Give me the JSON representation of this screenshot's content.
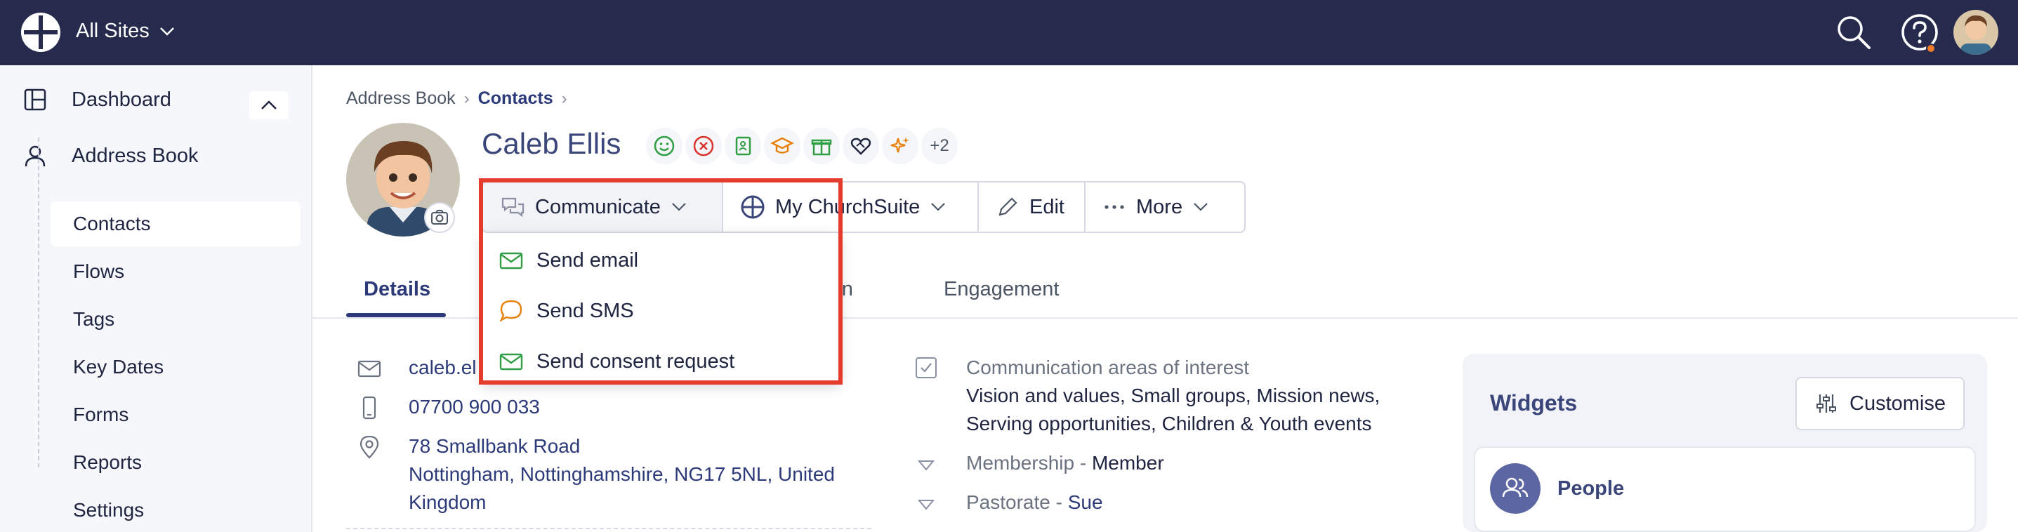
{
  "topbar": {
    "site_selector": "All Sites",
    "icons": [
      "church-logo-icon",
      "search-icon",
      "help-icon",
      "user-avatar"
    ],
    "colors": {
      "bar": "#262b4d",
      "notification": "#f07a2b"
    }
  },
  "sidebar": {
    "dashboard": "Dashboard",
    "address_book": "Address Book",
    "items": [
      "Contacts",
      "Flows",
      "Tags",
      "Key Dates",
      "Forms",
      "Reports",
      "Settings"
    ],
    "active_item": "Contacts"
  },
  "breadcrumb": {
    "root": "Address Book",
    "current": "Contacts"
  },
  "contact": {
    "name": "Caleb Ellis",
    "extra_badges": "+2",
    "badges": [
      "smile-icon",
      "x-circle-icon",
      "contact-book-icon",
      "graduation-cap-icon",
      "gift-icon",
      "heart-handshake-icon",
      "sparkles-icon"
    ]
  },
  "actions": {
    "communicate": "Communicate",
    "churchsuite": "My ChurchSuite",
    "edit": "Edit",
    "more": "More"
  },
  "communicate_menu": {
    "send_email": "Send email",
    "send_sms": "Send SMS",
    "send_consent": "Send consent request"
  },
  "tabs": {
    "details": "Details",
    "partial_tab": "ation",
    "engagement": "Engagement"
  },
  "details": {
    "email_partial": "caleb.el",
    "phone": "07700 900 033",
    "address_line1": "78 Smallbank Road",
    "address_line2": "Nottingham, Nottinghamshire, NG17 5NL, United",
    "address_line3": "Kingdom"
  },
  "fields": {
    "comm_label": "Communication areas of interest",
    "comm_value1": "Vision and values, Small groups, Mission news,",
    "comm_value2": "Serving opportunities, Children & Youth events",
    "membership_label": "Membership",
    "membership_value": "Member",
    "pastorate_label": "Pastorate",
    "pastorate_value": "Sue",
    "separator": " - "
  },
  "widgets": {
    "title": "Widgets",
    "customise": "Customise",
    "people": "People"
  }
}
